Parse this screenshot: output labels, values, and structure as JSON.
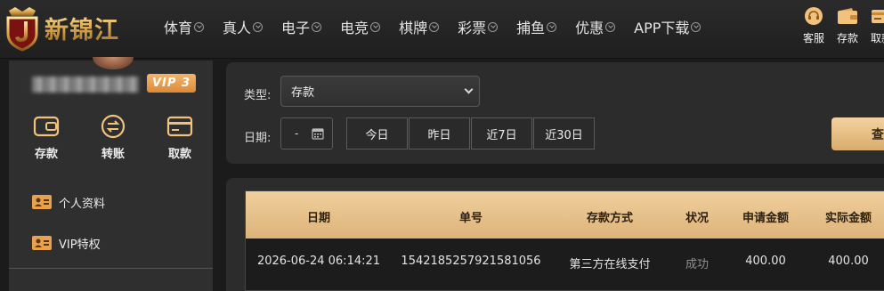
{
  "brand": {
    "logo_text": "新锦江",
    "accent_color": "#d9ac6b"
  },
  "nav": {
    "items": [
      {
        "label": "体育"
      },
      {
        "label": "真人"
      },
      {
        "label": "电子"
      },
      {
        "label": "电竞"
      },
      {
        "label": "棋牌"
      },
      {
        "label": "彩票"
      },
      {
        "label": "捕鱼"
      },
      {
        "label": "优惠"
      },
      {
        "label": "APP下载"
      }
    ],
    "actions": [
      {
        "label": "客服",
        "icon": "customer-service-icon"
      },
      {
        "label": "存款",
        "icon": "wallet-icon"
      },
      {
        "label": "取款",
        "icon": "withdraw-icon"
      }
    ]
  },
  "sidebar": {
    "vip_level": "VIP 3",
    "quick_actions": [
      {
        "label": "存款",
        "icon": "wallet-icon"
      },
      {
        "label": "转账",
        "icon": "transfer-icon"
      },
      {
        "label": "取款",
        "icon": "card-icon"
      }
    ],
    "menu": [
      {
        "label": "个人资料",
        "icon": "id-card-icon"
      },
      {
        "label": "VIP特权",
        "icon": "id-card-icon"
      }
    ]
  },
  "filters": {
    "type_label": "类型:",
    "type_value": "存款",
    "date_label": "日期:",
    "date_value": "-",
    "ranges": [
      {
        "label": "今日"
      },
      {
        "label": "昨日"
      },
      {
        "label": "近7日"
      },
      {
        "label": "近30日"
      }
    ],
    "search_label": "查"
  },
  "table": {
    "columns": [
      "日期",
      "单号",
      "存款方式",
      "状况",
      "申请金额",
      "实际金额"
    ],
    "rows": [
      {
        "date": "2026-06-24 06:14:21",
        "order_no": "1542185257921581056",
        "method": "第三方在线支付",
        "status": "成功",
        "requested": "400.00",
        "actual": "400.00"
      }
    ]
  }
}
